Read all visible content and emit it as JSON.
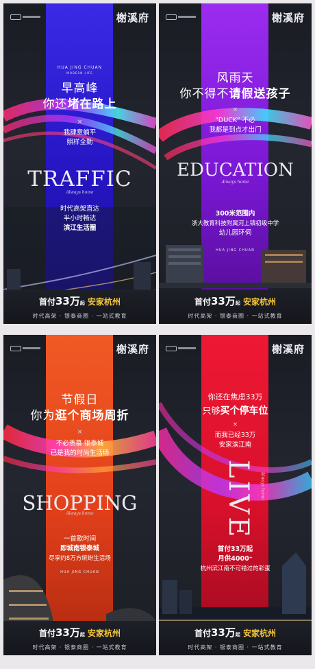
{
  "brand": "榭溪府",
  "subtitle_en": "HUA JING CHUAN",
  "subtitle_small": "MODERN LIFE",
  "script_word": "Always home",
  "bottom": {
    "prefix": "首付",
    "amount": "33万",
    "qi": "起",
    "home": "安家杭州",
    "tagline": "时代高架 · 银泰商圈 · 一站式教育"
  },
  "posters": [
    {
      "id": "traffic",
      "band_color": "#2f1fd8",
      "head1": "早高峰",
      "head2_a": "你还",
      "head2_b": "堵在路上",
      "x": "×",
      "sub1": "我肆意躺平",
      "sub2": "照样全勤",
      "big": "TRAFFIC",
      "body1": "时代高架直达",
      "body2": "半小时畅达",
      "body3": "滨江生活圈"
    },
    {
      "id": "education",
      "band_color": "#8a1fe0",
      "head1": "风雨天",
      "head2_a": "你不得不",
      "head2_b": "请假送孩子",
      "x": "×",
      "sub1": "“DUCK” 不必",
      "sub2": "我都是到点才出门",
      "big": "EDUCATION",
      "body1": "300米范围内",
      "body2": "浙大教育科技附属河上镇初级中学",
      "body3": "幼儿园环伺"
    },
    {
      "id": "shopping",
      "band_color": "#ee4d1c",
      "head1": "节假日",
      "head2_a": "你为",
      "head2_b": "逛个商场周折",
      "x": "×",
      "sub1": "不必羡慕 银泰城",
      "sub2": "已是我的时尚生活场",
      "big": "SHOPPING",
      "body1": "一首歌时间",
      "body2": "即城南银泰城",
      "body3": "尽享约8万方缤纷生活场"
    },
    {
      "id": "live",
      "band_color": "#e8122f",
      "head1_a": "你还在焦虑",
      "head1_b": "33万",
      "head2_a": "只够",
      "head2_b": "买个停车位",
      "x": "×",
      "sub1": "而我已经33万",
      "sub2": "安家滨江南",
      "big": "LIVE",
      "body1": "首付33万起",
      "body2": "月供4000⁺",
      "body3": "杭州滨江南不可错过的彩蛋"
    }
  ]
}
